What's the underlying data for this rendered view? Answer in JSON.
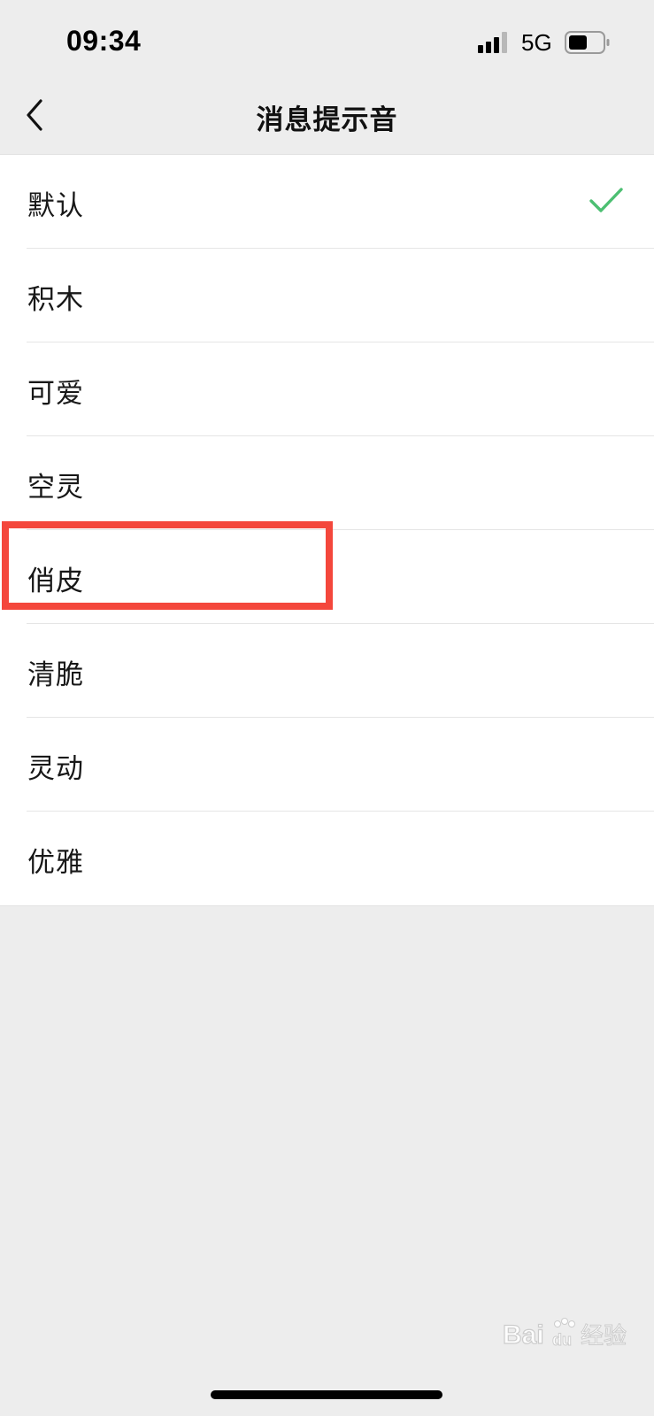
{
  "status_bar": {
    "time": "09:34",
    "network": "5G",
    "icons": [
      "signal-icon",
      "battery-icon"
    ]
  },
  "nav": {
    "title": "消息提示音",
    "back_icon": "chevron-left-icon"
  },
  "tones": {
    "items": [
      {
        "label": "默认",
        "selected": true
      },
      {
        "label": "积木",
        "selected": false
      },
      {
        "label": "可爱",
        "selected": false
      },
      {
        "label": "空灵",
        "selected": false
      },
      {
        "label": "俏皮",
        "selected": false
      },
      {
        "label": "清脆",
        "selected": false
      },
      {
        "label": "灵动",
        "selected": false
      },
      {
        "label": "优雅",
        "selected": false
      }
    ],
    "check_icon": "check-icon"
  },
  "annotation": {
    "highlighted_item": "俏皮",
    "color": "#f4473c"
  },
  "watermark": {
    "brand": "Bai",
    "brand_suffix": "du",
    "cn_label": "经验"
  },
  "colors": {
    "accent_check": "#4cbf72",
    "background": "#ededed",
    "list_bg": "#ffffff"
  }
}
